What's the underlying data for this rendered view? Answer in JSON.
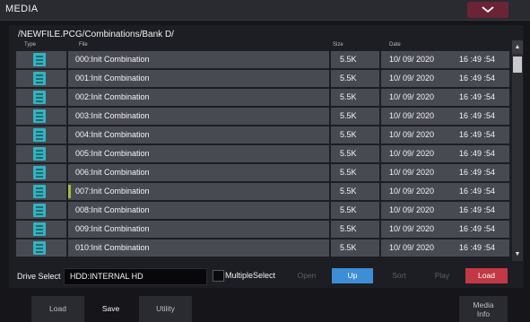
{
  "window": {
    "title": "MEDIA",
    "menu_icon": "chevron-down-icon"
  },
  "browser": {
    "path": "/NEWFILE.PCG/Combinations/Bank D/",
    "columns": {
      "type": "Type",
      "file": "File",
      "size": "Size",
      "date": "Date"
    },
    "rows": [
      {
        "file": "000:Init Combination",
        "size": "5.5K",
        "date": "10/  09/  2020",
        "time": "16  :49  :54"
      },
      {
        "file": "001:Init Combination",
        "size": "5.5K",
        "date": "10/  09/  2020",
        "time": "16  :49  :54"
      },
      {
        "file": "002:Init Combination",
        "size": "5.5K",
        "date": "10/  09/  2020",
        "time": "16  :49  :54"
      },
      {
        "file": "003:Init Combination",
        "size": "5.5K",
        "date": "10/  09/  2020",
        "time": "16  :49  :54"
      },
      {
        "file": "004:Init Combination",
        "size": "5.5K",
        "date": "10/  09/  2020",
        "time": "16  :49  :54"
      },
      {
        "file": "005:Init Combination",
        "size": "5.5K",
        "date": "10/  09/  2020",
        "time": "16  :49  :54"
      },
      {
        "file": "006:Init Combination",
        "size": "5.5K",
        "date": "10/  09/  2020",
        "time": "16  :49  :54"
      },
      {
        "file": "007:Init Combination",
        "size": "5.5K",
        "date": "10/  09/  2020",
        "time": "16  :49  :54"
      },
      {
        "file": "008:Init Combination",
        "size": "5.5K",
        "date": "10/  09/  2020",
        "time": "16  :49  :54"
      },
      {
        "file": "009:Init Combination",
        "size": "5.5K",
        "date": "10/  09/  2020",
        "time": "16  :49  :54"
      },
      {
        "file": "010:Init Combination",
        "size": "5.5K",
        "date": "10/  09/  2020",
        "time": "16  :49  :54"
      }
    ],
    "selected_index": 7,
    "icon": "combination-file-icon"
  },
  "controls": {
    "drive_select_label": "Drive Select",
    "drive_value": "HDD:INTERNAL HD",
    "multiple_select_label": "MultipleSelect",
    "multiple_select_checked": false,
    "open": "Open",
    "up": "Up",
    "sort": "Sort",
    "play": "Play",
    "load": "Load"
  },
  "tabs": {
    "load": "Load",
    "save": "Save",
    "utility": "Utility",
    "media_info_1": "Media",
    "media_info_2": "Info",
    "active": "save"
  },
  "colors": {
    "up_button": "#3d8ed6",
    "load_button": "#c33845",
    "selected_marker": "#9bbf3a",
    "file_icon": "#34b3bf"
  }
}
